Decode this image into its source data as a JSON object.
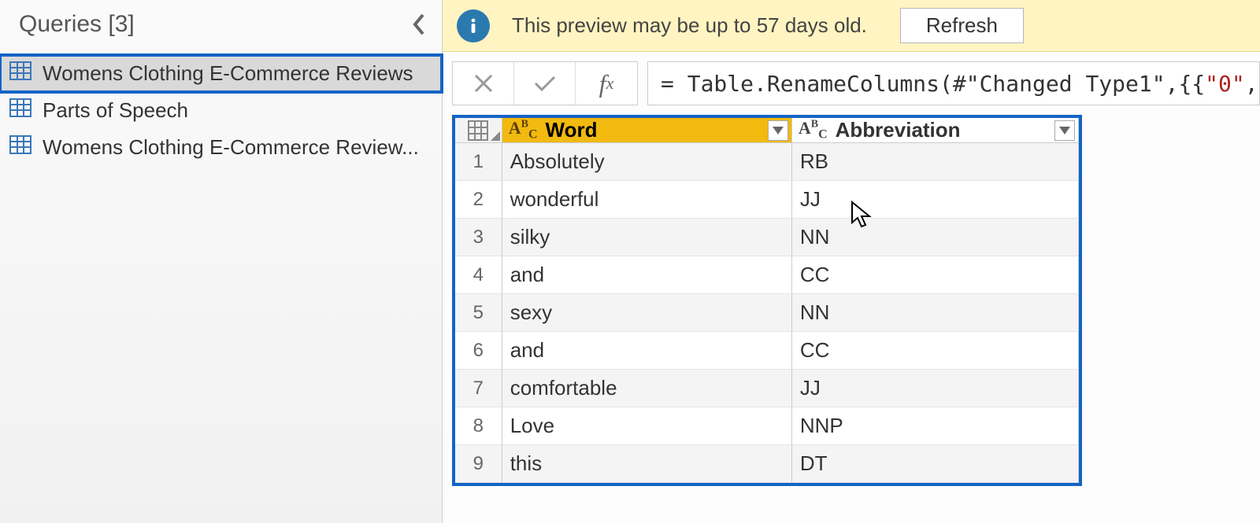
{
  "sidebar": {
    "title": "Queries [3]",
    "items": [
      {
        "label": "Womens Clothing E-Commerce Reviews",
        "selected": true
      },
      {
        "label": "Parts of Speech",
        "selected": false
      },
      {
        "label": "Womens Clothing E-Commerce Review...",
        "selected": false
      }
    ]
  },
  "warning": {
    "text": "This preview may be up to 57 days old.",
    "refresh_label": "Refresh"
  },
  "formula": {
    "prefix": "= Table.RenameColumns(#\"Changed Type1\",{{",
    "str": "\"0\"",
    "suffix": ", \""
  },
  "table": {
    "columns": [
      {
        "name": "Word",
        "type_icon": "AᴮC",
        "selected": true
      },
      {
        "name": "Abbreviation",
        "type_icon": "AᴮC",
        "selected": false
      }
    ],
    "rows": [
      {
        "n": "1",
        "word": "Absolutely",
        "abbr": "RB"
      },
      {
        "n": "2",
        "word": "wonderful",
        "abbr": "JJ"
      },
      {
        "n": "3",
        "word": "silky",
        "abbr": "NN"
      },
      {
        "n": "4",
        "word": "and",
        "abbr": "CC"
      },
      {
        "n": "5",
        "word": "sexy",
        "abbr": "NN"
      },
      {
        "n": "6",
        "word": "and",
        "abbr": "CC"
      },
      {
        "n": "7",
        "word": "comfortable",
        "abbr": "JJ"
      },
      {
        "n": "8",
        "word": "Love",
        "abbr": "NNP"
      },
      {
        "n": "9",
        "word": "this",
        "abbr": "DT"
      }
    ]
  }
}
